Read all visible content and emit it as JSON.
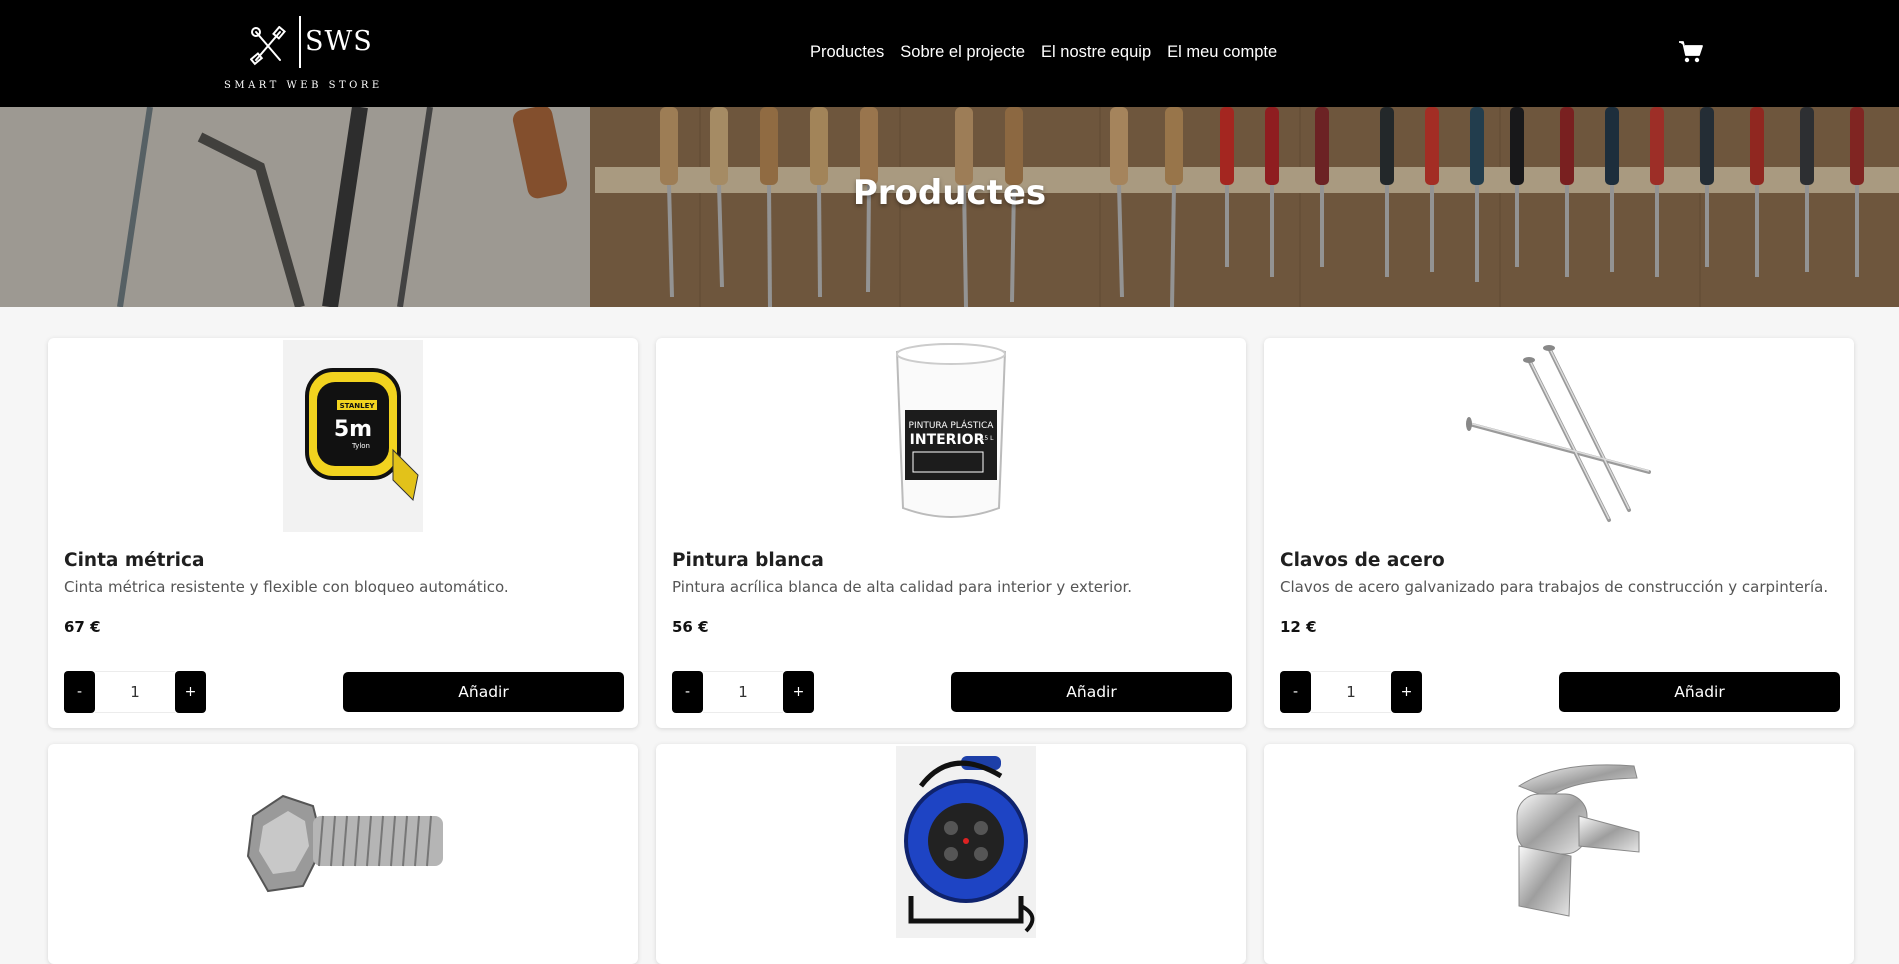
{
  "header": {
    "logo_text": "SWS",
    "logo_tagline": "SMART WEB STORE",
    "nav": [
      "Productes",
      "Sobre el projecte",
      "El nostre equip",
      "El meu compte"
    ],
    "cart_icon": "shopping-cart-icon"
  },
  "hero": {
    "title": "Productes"
  },
  "products": [
    {
      "name": "Cinta métrica",
      "description": "Cinta métrica resistente y flexible con bloqueo automático.",
      "price": "67 €",
      "quantity": "1",
      "minus_label": "-",
      "plus_label": "+",
      "add_label": "Añadir",
      "image_icon": "measuring-tape-image",
      "image_text": [
        "5m",
        "STANLEY",
        "Tylon"
      ]
    },
    {
      "name": "Pintura blanca",
      "description": "Pintura acrílica blanca de alta calidad para interior y exterior.",
      "price": "56 €",
      "quantity": "1",
      "minus_label": "-",
      "plus_label": "+",
      "add_label": "Añadir",
      "image_icon": "paint-bucket-image",
      "image_text": [
        "PINTURA PLÁSTICA",
        "INTERIOR",
        "15 L"
      ]
    },
    {
      "name": "Clavos de acero",
      "description": "Clavos de acero galvanizado para trabajos de construcción y carpintería.",
      "price": "12 €",
      "quantity": "1",
      "minus_label": "-",
      "plus_label": "+",
      "add_label": "Añadir",
      "image_icon": "steel-nails-image"
    },
    {
      "image_icon": "bolt-screw-image"
    },
    {
      "image_icon": "extension-cord-reel-image"
    },
    {
      "image_icon": "faucet-image"
    }
  ]
}
